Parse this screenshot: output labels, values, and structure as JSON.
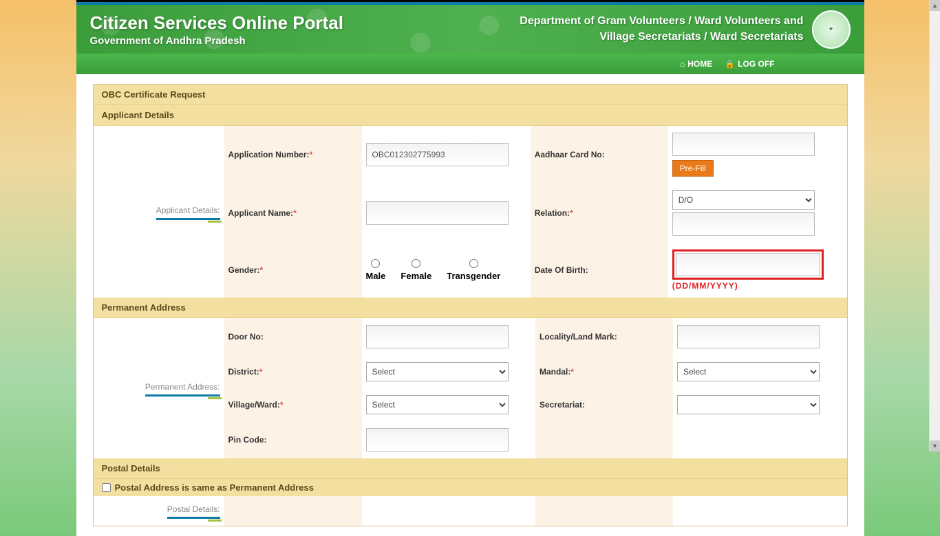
{
  "header": {
    "title": "Citizen Services Online Portal",
    "subtitle": "Government of Andhra Pradesh",
    "department_line1": "Department of Gram Volunteers / Ward Volunteers and",
    "department_line2": "Village Secretariats / Ward Secretariats"
  },
  "nav": {
    "home": "HOME",
    "logoff": "LOG OFF"
  },
  "sections": {
    "request_title": "OBC Certificate Request",
    "applicant_details": "Applicant Details",
    "permanent_address": "Permanent Address",
    "postal_details": "Postal Details",
    "postal_same_label": "Postal Address is same as Permanent Address"
  },
  "sidebar": {
    "applicant": "Applicant Details:",
    "permanent": "Permanent Address:",
    "postal": "Postal Details:"
  },
  "fields": {
    "application_number": "Application Number:",
    "application_number_value": "OBC012302775993",
    "aadhaar": "Aadhaar Card No:",
    "prefill": "Pre-Fill",
    "applicant_name": "Applicant Name:",
    "relation": "Relation:",
    "relation_value": "D/O",
    "gender": "Gender:",
    "gender_male": "Male",
    "gender_female": "Female",
    "gender_trans": "Transgender",
    "dob": "Date Of Birth:",
    "dob_hint": "(DD/MM/YYYY)",
    "door_no": "Door No:",
    "locality": "Locality/Land Mark:",
    "district": "District:",
    "mandal": "Mandal:",
    "village": "Village/Ward:",
    "secretariat": "Secretariat:",
    "pincode": "Pin Code:",
    "select_opt": "Select"
  }
}
